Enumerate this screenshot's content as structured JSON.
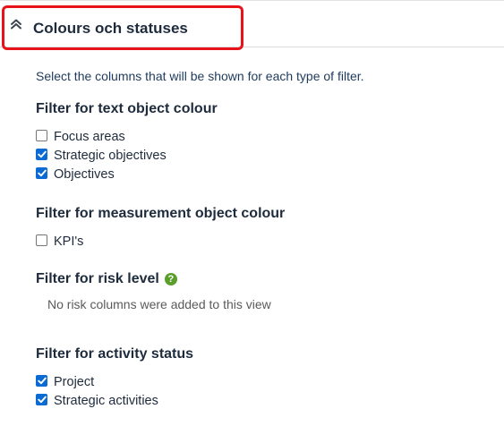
{
  "section": {
    "title": "Colours och statuses",
    "intro": "Select the columns that will be shown for each type of filter."
  },
  "groups": {
    "text_colour": {
      "title": "Filter for text object colour",
      "items": [
        {
          "label": "Focus areas",
          "checked": false
        },
        {
          "label": "Strategic objectives",
          "checked": true
        },
        {
          "label": "Objectives",
          "checked": true
        }
      ]
    },
    "measurement_colour": {
      "title": "Filter for measurement object colour",
      "items": [
        {
          "label": "KPI's",
          "checked": false
        }
      ]
    },
    "risk_level": {
      "title": "Filter for risk level",
      "help_icon": "?",
      "note": "No risk columns were added to this view"
    },
    "activity_status": {
      "title": "Filter for activity status",
      "items": [
        {
          "label": "Project",
          "checked": true
        },
        {
          "label": "Strategic activities",
          "checked": true
        }
      ]
    }
  },
  "colors": {
    "accent_checkbox": "#0b6bd4",
    "highlight": "#e8131a",
    "help_icon": "#5a9e2c"
  }
}
